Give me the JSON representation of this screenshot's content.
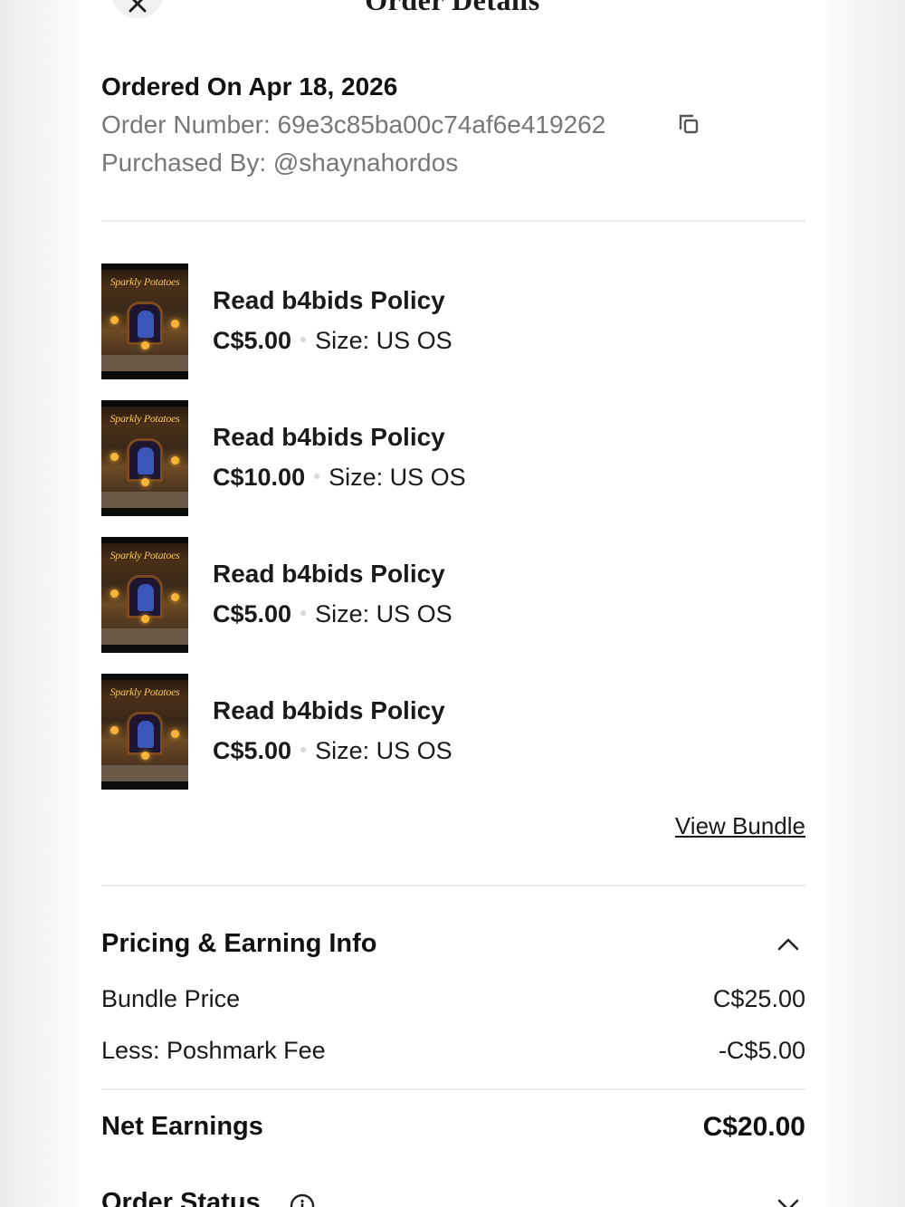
{
  "header": {
    "title": "Order Details"
  },
  "order": {
    "date": "Ordered On Apr 18, 2026",
    "number_line": "Order Number: 69e3c85ba00c74af6e419262",
    "purchased_by_line": "Purchased By:  @shaynahordos"
  },
  "items": [
    {
      "thumb_title": "Sparkly Potatoes",
      "title": "Read b4bids Policy",
      "price": "C$5.00",
      "size": "Size: US OS"
    },
    {
      "thumb_title": "Sparkly Potatoes",
      "title": "Read b4bids Policy",
      "price": "C$10.00",
      "size": "Size: US OS"
    },
    {
      "thumb_title": "Sparkly Potatoes",
      "title": "Read b4bids Policy",
      "price": "C$5.00",
      "size": "Size: US OS"
    },
    {
      "thumb_title": "Sparkly Potatoes",
      "title": "Read b4bids Policy",
      "price": "C$5.00",
      "size": "Size: US OS"
    }
  ],
  "bundle_link": "View Bundle",
  "pricing": {
    "title": "Pricing & Earning Info",
    "rows": [
      {
        "label": "Bundle Price",
        "value": "C$25.00"
      },
      {
        "label": "Less: Poshmark Fee",
        "value": "-C$5.00"
      }
    ],
    "net_label": "Net Earnings",
    "net_value": "C$20.00"
  },
  "status": {
    "title": "Order Status"
  },
  "icons": {
    "back": "close-icon",
    "copy": "copy-icon",
    "pricing_toggle": "chevron-up-icon",
    "status_info": "info-icon",
    "status_toggle": "chevron-down-icon"
  },
  "colors": {
    "primary_text": "#1a1a1a",
    "secondary_text": "#777777",
    "divider": "#ececec",
    "background": "#ffffff"
  }
}
